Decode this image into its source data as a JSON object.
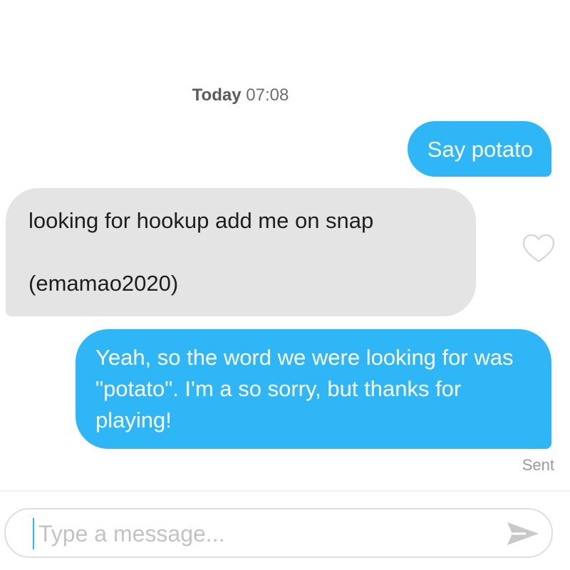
{
  "timestamp": {
    "day": "Today",
    "time": "07:08"
  },
  "messages": [
    {
      "direction": "outgoing",
      "text": "Say potato"
    },
    {
      "direction": "incoming",
      "text": "looking for hookup add me on snap\n\n(emamao2020)"
    },
    {
      "direction": "outgoing",
      "text": "Yeah, so the word we were looking for was \"potato\". I'm a so sorry, but thanks for playing!"
    }
  ],
  "status": {
    "sent_label": "Sent"
  },
  "composer": {
    "placeholder": "Type a message...",
    "value": ""
  },
  "icons": {
    "like": "heart-outline-icon",
    "send": "send-arrow-icon"
  },
  "colors": {
    "outgoing_bubble": "#2fb6f7",
    "incoming_bubble": "#e4e4e4",
    "send_icon": "#c9c9c9"
  }
}
